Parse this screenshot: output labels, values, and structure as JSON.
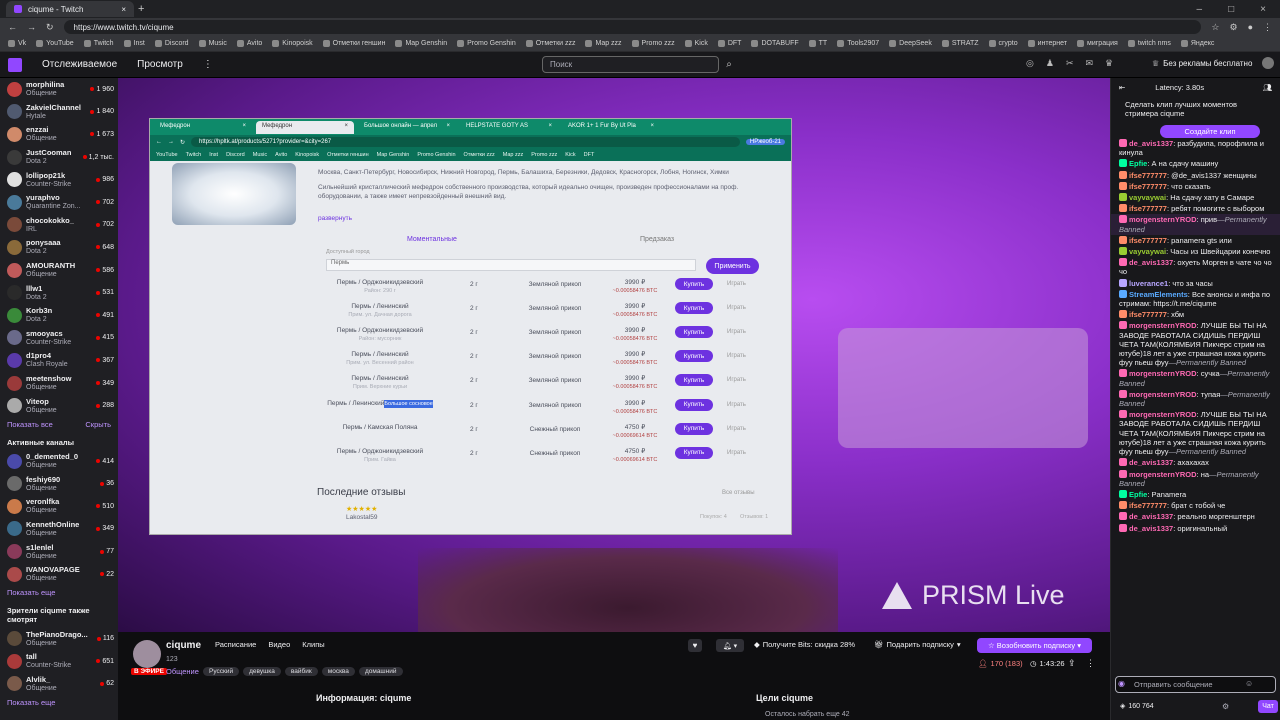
{
  "browser": {
    "tab_title": "ciqume - Twitch",
    "url": "https://www.twitch.tv/ciqume",
    "bookmarks": [
      "Vk",
      "YouTube",
      "Twitch",
      "Inst",
      "Discord",
      "Music",
      "Avito",
      "Kinopoisk",
      "Отметки геншин",
      "Map Genshin",
      "Promo Genshin",
      "Отметки zzz",
      "Map zzz",
      "Promo zzz",
      "Kick",
      "DFT",
      "DOTABUFF",
      "TT",
      "Tools2907",
      "DeepSeek",
      "STRATZ",
      "crypto",
      "интернет",
      "миграция",
      "twitch nms",
      "Яндекс"
    ]
  },
  "topnav": {
    "following": "Отслеживаемое",
    "browse": "Просмотр",
    "more": "⋮",
    "search_placeholder": "Поиск",
    "turbo": "Без рекламы бесплатно"
  },
  "sidebar": {
    "followed": [
      {
        "name": "morphilina",
        "game": "Общение",
        "viewers": "1 960",
        "color": "#c04040"
      },
      {
        "name": "ZakvielChannel",
        "game": "Hytale",
        "viewers": "1 840",
        "color": "#505a70"
      },
      {
        "name": "enzzai",
        "game": "Общение",
        "viewers": "1 673",
        "color": "#d08a6a"
      },
      {
        "name": "JustCooman",
        "game": "Dota 2",
        "viewers": "1,2 тыс.",
        "color": "#3a3a3a"
      },
      {
        "name": "lollipop21k",
        "game": "Counter-Strike",
        "viewers": "986",
        "color": "#e0e0e0"
      },
      {
        "name": "yuraphvo",
        "game": "Quarantine Zon...",
        "viewers": "702",
        "color": "#4a7a9a"
      },
      {
        "name": "chocokokko_",
        "game": "IRL",
        "viewers": "702",
        "color": "#7a4a3a"
      },
      {
        "name": "ponysaaa",
        "game": "Dota 2",
        "viewers": "648",
        "color": "#8a6a3a"
      },
      {
        "name": "AMOURANTH",
        "game": "Общение",
        "viewers": "586",
        "color": "#c05a5a"
      },
      {
        "name": "lllw1",
        "game": "Dota 2",
        "viewers": "531",
        "color": "#2a2a2a"
      },
      {
        "name": "Korb3n",
        "game": "Dota 2",
        "viewers": "491",
        "color": "#3a8a3a"
      },
      {
        "name": "smooyacs",
        "game": "Counter-Strike",
        "viewers": "415",
        "color": "#6a6a8a"
      },
      {
        "name": "d1pro4",
        "game": "Clash Royale",
        "viewers": "367",
        "color": "#5a3aaa"
      },
      {
        "name": "meetenshow",
        "game": "Общение",
        "viewers": "349",
        "color": "#9a3a3a"
      },
      {
        "name": "Viteop",
        "game": "Общение",
        "viewers": "288",
        "color": "#aaaaaa"
      }
    ],
    "show_more": "Показать все",
    "hide": "Скрыть",
    "active_title": "Активные каналы",
    "active": [
      {
        "name": "0_demented_0",
        "game": "Общение",
        "viewers": "414",
        "color": "#4a4aaa"
      },
      {
        "name": "feshiy690",
        "game": "Общение",
        "viewers": "36",
        "color": "#6a6a6a"
      },
      {
        "name": "veronlfka",
        "game": "Общение",
        "viewers": "510",
        "color": "#ca7a4a"
      },
      {
        "name": "KennethOnline",
        "game": "Общение",
        "viewers": "349",
        "color": "#3a6a8a"
      },
      {
        "name": "s1lenlel",
        "game": "Общение",
        "viewers": "77",
        "color": "#8a3a5a"
      },
      {
        "name": "IVANOVAPAGE",
        "game": "Общение",
        "viewers": "22",
        "color": "#aa4a4a"
      }
    ],
    "show_more2": "Показать еще",
    "viewers_title": "Зрители ciqume также смотрят",
    "also": [
      {
        "name": "ThePianoDrago...",
        "game": "Общение",
        "viewers": "116",
        "color": "#5a4a3a"
      },
      {
        "name": "tall",
        "game": "Counter-Strike",
        "viewers": "651",
        "color": "#aa3a3a"
      },
      {
        "name": "Alvlik_",
        "game": "Общение",
        "viewers": "62",
        "color": "#7a5a4a"
      }
    ],
    "show_more3": "Показать еще"
  },
  "captured": {
    "tabs": [
      "Мефедрон",
      "Мефедрон",
      "Большое онлайн — апрел",
      "HELPSTATE GOTY AS",
      "AKOR 1+ 1 Fur By Ut Pla"
    ],
    "url": "https://hpltk.at/products/5271?provider=&city=267",
    "ext": "НРжеоб-21",
    "bookmarks": [
      "YouTube",
      "Twitch",
      "Inst",
      "Discord",
      "Music",
      "Avito",
      "Kinopoisk",
      "Отметки геншин",
      "Map Genshin",
      "Promo Genshin",
      "Отметки zzz",
      "Map zzz",
      "Promo zzz",
      "Kick",
      "DFT"
    ],
    "cities": "Москва, Санкт-Петербург, Новосибирск, Нижний Новгород, Пермь, Балашиха, Березники, Дедовск, Красногорск, Лобня, Ногинск, Химки",
    "description": "Сильнейший кристаллический мефедрон собственного производства, который идеально очищен, произведен профессионалами на проф. оборудовании, а также имеет непревзойденный внешний вид.",
    "expand": "развернуть",
    "tab_instant": "Моментальные",
    "tab_preorder": "Предзаказ",
    "city_label": "Доступный город",
    "city_value": "Пермь",
    "apply": "Применить",
    "rows": [
      {
        "loc": "Пермь / Орджоникидзевский",
        "sub": "Район: 290 г",
        "w": "2 г",
        "type": "Земляной прикоп",
        "price": "3990 ₽",
        "old": "~0.00058476 BTC"
      },
      {
        "loc": "Пермь / Ленинский",
        "sub": "Прим. ул. Дачная дорога",
        "w": "2 г",
        "type": "Земляной прикоп",
        "price": "3990 ₽",
        "old": "~0.00058476 BTC"
      },
      {
        "loc": "Пермь / Орджоникидзевский",
        "sub": "Район: мусорник",
        "w": "2 г",
        "type": "Земляной прикоп",
        "price": "3990 ₽",
        "old": "~0.00058476 BTC"
      },
      {
        "loc": "Пермь / Ленинский",
        "sub": "Прим. ул. Весенний район",
        "w": "2 г",
        "type": "Земляной прикоп",
        "price": "3990 ₽",
        "old": "~0.00058476 BTC"
      },
      {
        "loc": "Пермь / Ленинский",
        "sub": "Прим. Верхние курьи",
        "w": "2 г",
        "type": "Земляной прикоп",
        "price": "3990 ₽",
        "old": "~0.00058476 BTC"
      },
      {
        "loc": "Пермь / Ленинский",
        "sub": "Большое сосновое",
        "w": "2 г",
        "type": "Земляной прикоп",
        "price": "3990 ₽",
        "old": "~0.00058476 BTC"
      },
      {
        "loc": "Пермь / Камская Поляна",
        "sub": "",
        "w": "2 г",
        "type": "Снежный прикоп",
        "price": "4750 ₽",
        "old": "~0.00069614 BTC"
      },
      {
        "loc": "Пермь / Орджоникидзевский",
        "sub": "Прим. Гайва",
        "w": "2 г",
        "type": "Снежный прикоп",
        "price": "4750 ₽",
        "old": "~0.00069614 BTC"
      }
    ],
    "buy": "Купить",
    "play": "Играть",
    "reviews": "Последние отзывы",
    "all_reviews": "Все отзывы",
    "reviewer": "Lakostal59",
    "stars": "★★★★★",
    "footer_left": "Покупок: 4",
    "footer_right": "Отзывов: 1"
  },
  "stream": {
    "watermark": "PRISM Live",
    "channel": "ciqume",
    "live": "В ЭФИРЕ",
    "viewers_small": "123",
    "category": "Общение",
    "tags": [
      "Русский",
      "девушка",
      "вайбик",
      "москва",
      "домашний"
    ],
    "links": [
      "Расписание",
      "Видео",
      "Клипы"
    ],
    "bits": "Получите Bits: скидка 28%",
    "gift": "Подарить подписку",
    "subscribe": "Возобновить подписку",
    "viewer_count": "170 (183)",
    "uptime": "1:43:26",
    "about": "Информация: ciqume",
    "goals": "Цели ciqume",
    "goal_text": "Осталось набрать еще 42"
  },
  "chat": {
    "latency": "Latency: 3.80s",
    "clip_prompt": "Сделать клип лучших моментов стримера ciqume",
    "clip_button": "Создайте клип",
    "messages": [
      {
        "user": "de_avis1337",
        "color": "#ff69b4",
        "text": "разбудила, порофлила и кинула",
        "hl": false
      },
      {
        "user": "Epfie",
        "color": "#00ffa0",
        "text": "А на сдачу машину",
        "hl": false
      },
      {
        "user": "ifse777777",
        "color": "#ff8c69",
        "text": "@de_avis1337 женщины",
        "hl": false
      },
      {
        "user": "ifse777777",
        "color": "#ff8c69",
        "text": "что сказать",
        "hl": false
      },
      {
        "user": "vayvaywai",
        "color": "#9acd32",
        "text": "На сдачу хату в Самаре",
        "hl": false
      },
      {
        "user": "ifse777777",
        "color": "#ff8c69",
        "text": "ребят помогите с выбором",
        "hl": false
      },
      {
        "user": "morgensternYROD",
        "color": "#ff69b4",
        "text": "прив",
        "ban": "—Permanently Banned",
        "hl": true
      },
      {
        "user": "ifse777777",
        "color": "#ff8c69",
        "text": "panamera gts или",
        "hl": false
      },
      {
        "user": "vayvaywai",
        "color": "#9acd32",
        "text": "Часы из Швейцарии конечно",
        "hl": false
      },
      {
        "user": "de_avis1337",
        "color": "#ff69b4",
        "text": "охуеть Морген в чате чо чо чо",
        "hl": false
      },
      {
        "user": "luverance1",
        "color": "#b8a6ff",
        "text": "что за часы",
        "hl": false
      },
      {
        "user": "StreamElements",
        "color": "#5aaaff",
        "text": "Все анонсы и инфа по стримам: https://t.me/ciqume",
        "hl": false
      },
      {
        "user": "ifse777777",
        "color": "#ff8c69",
        "text": "хбм",
        "hl": false
      },
      {
        "user": "morgensternYROD",
        "color": "#ff69b4",
        "text": "ЛУЧШЕ БЫ ТЫ НА ЗАВОДЕ РАБОТАЛА СИДИШЬ ПЕРДИШ ЧЕТА ТАМ(КОЛЯМБИЯ Пикчерс стрим на ютубе)18 лет а уже страшная кожа курить фуу пьеш фуу",
        "ban": "—Permanently Banned",
        "hl": false
      },
      {
        "user": "morgensternYROD",
        "color": "#ff69b4",
        "text": "сучка",
        "ban": "—Permanently Banned",
        "hl": false
      },
      {
        "user": "morgensternYROD",
        "color": "#ff69b4",
        "text": "тупая",
        "ban": "—Permanently Banned",
        "hl": false
      },
      {
        "user": "morgensternYROD",
        "color": "#ff69b4",
        "text": "ЛУЧШЕ БЫ ТЫ НА ЗАВОДЕ РАБОТАЛА СИДИШЬ ПЕРДИШ ЧЕТА ТАМ(КОЛЯМБИЯ Пикчерс стрим на ютубе)18 лет а уже страшная кожа курить фуу пьеш фуу",
        "ban": "—Permanently Banned",
        "hl": false
      },
      {
        "user": "de_avis1337",
        "color": "#ff69b4",
        "text": "ахахахах",
        "hl": false
      },
      {
        "user": "morgensternYROD",
        "color": "#ff69b4",
        "text": "на",
        "ban": "—Permanently Banned",
        "hl": false
      },
      {
        "user": "Epfie",
        "color": "#00ffa0",
        "text": "Panamera",
        "hl": false
      },
      {
        "user": "ifse777777",
        "color": "#ff8c69",
        "text": "брат с тобой че",
        "hl": false
      },
      {
        "user": "de_avis1337",
        "color": "#ff69b4",
        "text": "реально моргенштерн",
        "hl": false
      },
      {
        "user": "de_avis1337",
        "color": "#ff69b4",
        "text": "оригинальный",
        "hl": false
      }
    ],
    "placeholder": "Отправить сообщение",
    "points": "160 764",
    "chat_button": "Чат"
  }
}
